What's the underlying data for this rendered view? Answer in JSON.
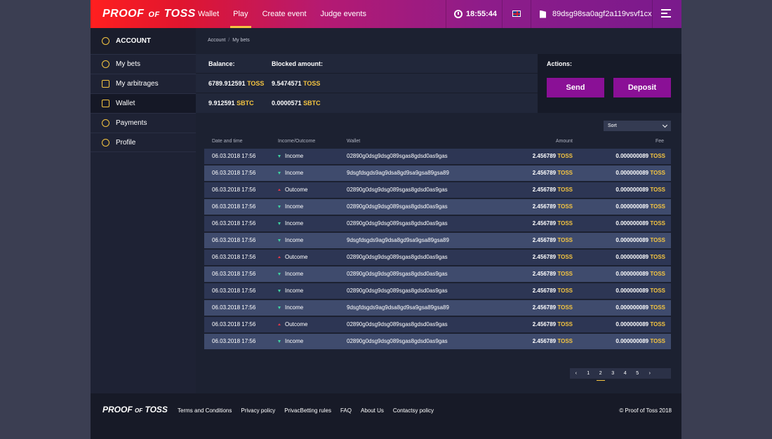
{
  "header": {
    "logo_left": "PROOF",
    "logo_of": "OF",
    "logo_right": "TOSS",
    "nav": [
      "Wallet",
      "Play",
      "Create event",
      "Judge events"
    ],
    "active_nav": "Play",
    "time": "18:55:44",
    "wallet_address": "89dsg98sa0agf2a119vsvf1cx"
  },
  "sidebar": {
    "title": "ACCOUNT",
    "items": [
      {
        "label": "My bets",
        "icon": "coin-icon"
      },
      {
        "label": "My arbitrages",
        "icon": "scales-icon"
      },
      {
        "label": "Wallet",
        "icon": "wallet-icon"
      },
      {
        "label": "Payments",
        "icon": "coins-icon"
      },
      {
        "label": "Profile",
        "icon": "user-settings-icon"
      }
    ],
    "active": "Wallet"
  },
  "breadcrumb": [
    "Account",
    "My bets"
  ],
  "balance": {
    "balance_label": "Balance:",
    "blocked_label": "Blocked amount:",
    "rows": [
      {
        "balance": "6789.912591",
        "balance_cur": "TOSS",
        "blocked": "9.5474571",
        "blocked_cur": "TOSS"
      },
      {
        "balance": "9.912591",
        "balance_cur": "SBTC",
        "blocked": "0.0000571",
        "blocked_cur": "SBTC"
      }
    ]
  },
  "actions": {
    "label": "Actions:",
    "send": "Send",
    "deposit": "Deposit"
  },
  "sort": {
    "label": "Sort"
  },
  "table": {
    "headers": [
      "Date and time",
      "Income/Outcome",
      "Wallet",
      "Amount",
      "Fee"
    ],
    "rows": [
      {
        "date": "06.03.2018 17:56",
        "type": "Income",
        "wallet": "02890g0dsg9dsg089sgas8gdsd0as9gas",
        "amount": "2.456789",
        "amount_cur": "TOSS",
        "fee": "0.000000089",
        "fee_cur": "TOSS"
      },
      {
        "date": "06.03.2018 17:56",
        "type": "Income",
        "wallet": "9dsgfdsgds9ag9dsa8gd9sa9gsa89gsa89",
        "amount": "2.456789",
        "amount_cur": "TOSS",
        "fee": "0.000000089",
        "fee_cur": "TOSS"
      },
      {
        "date": "06.03.2018 17:56",
        "type": "Outcome",
        "wallet": "02890g0dsg9dsg089sgas8gdsd0as9gas",
        "amount": "2.456789",
        "amount_cur": "TOSS",
        "fee": "0.000000089",
        "fee_cur": "TOSS"
      },
      {
        "date": "06.03.2018 17:56",
        "type": "Income",
        "wallet": "02890g0dsg9dsg089sgas8gdsd0as9gas",
        "amount": "2.456789",
        "amount_cur": "TOSS",
        "fee": "0.000000089",
        "fee_cur": "TOSS"
      },
      {
        "date": "06.03.2018 17:56",
        "type": "Income",
        "wallet": "02890g0dsg9dsg089sgas8gdsd0as9gas",
        "amount": "2.456789",
        "amount_cur": "TOSS",
        "fee": "0.000000089",
        "fee_cur": "TOSS"
      },
      {
        "date": "06.03.2018 17:56",
        "type": "Income",
        "wallet": "9dsgfdsgds9ag9dsa8gd9sa9gsa89gsa89",
        "amount": "2.456789",
        "amount_cur": "TOSS",
        "fee": "0.000000089",
        "fee_cur": "TOSS"
      },
      {
        "date": "06.03.2018 17:56",
        "type": "Outcome",
        "wallet": "02890g0dsg9dsg089sgas8gdsd0as9gas",
        "amount": "2.456789",
        "amount_cur": "TOSS",
        "fee": "0.000000089",
        "fee_cur": "TOSS"
      },
      {
        "date": "06.03.2018 17:56",
        "type": "Income",
        "wallet": "02890g0dsg9dsg089sgas8gdsd0as9gas",
        "amount": "2.456789",
        "amount_cur": "TOSS",
        "fee": "0.000000089",
        "fee_cur": "TOSS"
      },
      {
        "date": "06.03.2018 17:56",
        "type": "Income",
        "wallet": "02890g0dsg9dsg089sgas8gdsd0as9gas",
        "amount": "2.456789",
        "amount_cur": "TOSS",
        "fee": "0.000000089",
        "fee_cur": "TOSS"
      },
      {
        "date": "06.03.2018 17:56",
        "type": "Income",
        "wallet": "9dsgfdsgds9ag9dsa8gd9sa9gsa89gsa89",
        "amount": "2.456789",
        "amount_cur": "TOSS",
        "fee": "0.000000089",
        "fee_cur": "TOSS"
      },
      {
        "date": "06.03.2018 17:56",
        "type": "Outcome",
        "wallet": "02890g0dsg9dsg089sgas8gdsd0as9gas",
        "amount": "2.456789",
        "amount_cur": "TOSS",
        "fee": "0.000000089",
        "fee_cur": "TOSS"
      },
      {
        "date": "06.03.2018 17:56",
        "type": "Income",
        "wallet": "02890g0dsg9dsg089sgas8gdsd0as9gas",
        "amount": "2.456789",
        "amount_cur": "TOSS",
        "fee": "0.000000089",
        "fee_cur": "TOSS"
      }
    ]
  },
  "pagination": {
    "prev": "‹",
    "pages": [
      "1",
      "2",
      "3",
      "4",
      "5"
    ],
    "current": "2",
    "next": "›"
  },
  "footer": {
    "logo_left": "PROOF",
    "logo_of": "OF",
    "logo_right": "TOSS",
    "links": [
      "Terms and Conditions",
      "Privacy policy",
      "PrivacBetting rules",
      "FAQ",
      "About Us",
      "Contactsy policy"
    ],
    "copyright": "© Proof of Toss 2018"
  },
  "colors": {
    "accent": "#f5c541",
    "button": "#8a1096",
    "income": "#3fd3a2",
    "outcome": "#e5394a"
  }
}
